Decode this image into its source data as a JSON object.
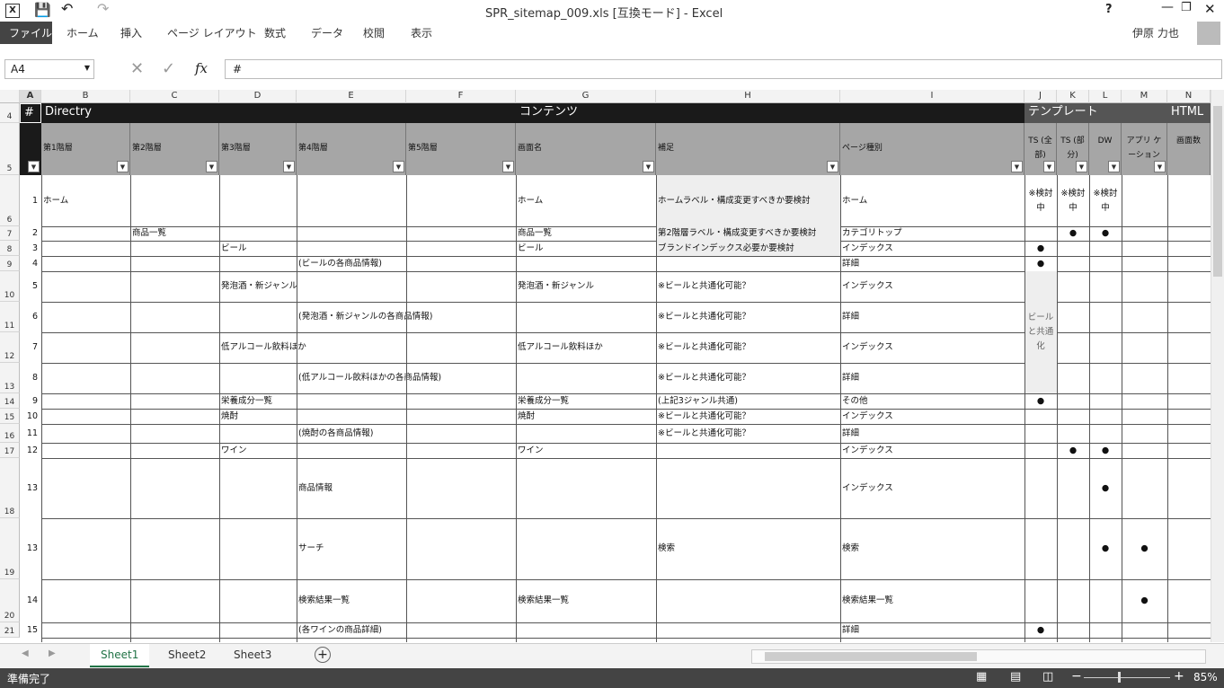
{
  "window": {
    "title": "SPR_sitemap_009.xls [互換モード] - Excel",
    "help": "?",
    "user": "伊原 力也"
  },
  "ribbon": {
    "file": "ファイル",
    "tabs": [
      "ホーム",
      "挿入",
      "ページ レイアウト",
      "数式",
      "データ",
      "校閲",
      "表示"
    ]
  },
  "formula": {
    "name_box": "A4",
    "value": "#",
    "fx": "fx"
  },
  "columns": [
    "A",
    "B",
    "C",
    "D",
    "E",
    "F",
    "G",
    "H",
    "I",
    "J",
    "K",
    "L",
    "M",
    "N"
  ],
  "group_headers": {
    "a": "#",
    "dir": "Directry",
    "contents": "コンテンツ",
    "template": "テンプレート",
    "html": "HTML"
  },
  "sub_headers": {
    "b": "第1階層",
    "c": "第2階層",
    "d": "第3階層",
    "e": "第4階層",
    "f": "第5階層",
    "g": "画面名",
    "h": "補足",
    "i": "ページ種別",
    "j": "TS (全部)",
    "k": "TS (部分)",
    "l": "DW",
    "m": "アプリ ケーション",
    "n": "画面数"
  },
  "row_numbers": [
    "4",
    "5",
    "6",
    "7",
    "8",
    "9",
    "10",
    "11",
    "12",
    "13",
    "14",
    "15",
    "16",
    "17",
    "18",
    "19",
    "20",
    "21"
  ],
  "rows": [
    {
      "num": "1",
      "b": "ホーム",
      "g": "ホーム",
      "h": "ホームラベル・構成変更すべきか要検討",
      "i": "ホーム",
      "j": "※検討 中",
      "k": "※検討 中",
      "l": "※検討 中"
    },
    {
      "num": "2",
      "c": "商品一覧",
      "g": "商品一覧",
      "h": "第2階層ラベル・構成変更すべきか要検討",
      "i": "カテゴリトップ",
      "k": "●",
      "l": "●"
    },
    {
      "num": "3",
      "d": "ビール",
      "g": "ビール",
      "h": "ブランドインデックス必要か要検討",
      "i": "インデックス",
      "j": "●"
    },
    {
      "num": "4",
      "e": "(ビールの各商品情報)",
      "i": "詳細",
      "j": "●"
    },
    {
      "num": "5",
      "d": "発泡酒・新ジャンル",
      "g": "発泡酒・新ジャンル",
      "h": "※ビールと共通化可能？",
      "i": "インデックス"
    },
    {
      "num": "6",
      "e": "(発泡酒・新ジャンルの各商品情報)",
      "h": "※ビールと共通化可能？",
      "i": "詳細"
    },
    {
      "num": "7",
      "d": "低アルコール飲料ほか",
      "g": "低アルコール飲料ほか",
      "h": "※ビールと共通化可能？",
      "i": "インデックス"
    },
    {
      "num": "8",
      "e": "(低アルコール飲料ほかの各商品情報)",
      "h": "※ビールと共通化可能？",
      "i": "詳細"
    },
    {
      "num": "9",
      "d": "栄養成分一覧",
      "g": "栄養成分一覧",
      "h": "(上記3ジャンル共通)",
      "i": "その他",
      "j": "●"
    },
    {
      "num": "10",
      "d": "焼酎",
      "g": "焼酎",
      "h": "※ビールと共通化可能？",
      "i": "インデックス"
    },
    {
      "num": "11",
      "e": "(焼酎の各商品情報)",
      "h": "※ビールと共通化可能？",
      "i": "詳細"
    },
    {
      "num": "12",
      "d": "ワイン",
      "g": "ワイン",
      "i": "インデックス",
      "k": "●",
      "l": "●"
    },
    {
      "num": "13",
      "e": "商品情報",
      "i": "インデックス",
      "l": "●"
    },
    {
      "num": "13",
      "e": "サーチ",
      "h": "検索",
      "i": "検索",
      "l": "●",
      "m": "●"
    },
    {
      "num": "14",
      "e": "検索結果一覧",
      "g": "検索結果一覧",
      "i": "検索結果一覧",
      "m": "●"
    },
    {
      "num": "15",
      "e": "(各ワインの商品詳細)",
      "i": "詳細",
      "j": "●"
    }
  ],
  "merged_note": "ビールと共通化",
  "sheets": [
    "Sheet1",
    "Sheet2",
    "Sheet3"
  ],
  "status": {
    "ready": "準備完了",
    "zoom": "85%"
  }
}
